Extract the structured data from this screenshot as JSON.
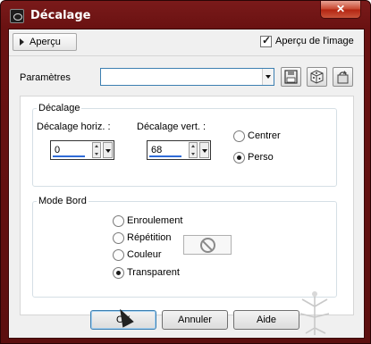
{
  "window": {
    "title": "Décalage",
    "close_glyph": "✕"
  },
  "toolbar": {
    "apercu_label": "Aperçu",
    "apercu_check_label": "Aperçu de l'image",
    "apercu_checked": true
  },
  "parametres": {
    "label": "Paramètres",
    "value": ""
  },
  "decalage": {
    "group_title": "Décalage",
    "horiz_label": "Décalage horiz. :",
    "horiz_value": "0",
    "vert_label": "Décalage vert. :",
    "vert_value": "68",
    "options": [
      {
        "label": "Centrer",
        "selected": false
      },
      {
        "label": "Perso",
        "selected": true
      }
    ]
  },
  "mode_bord": {
    "group_title": "Mode Bord",
    "options": [
      {
        "label": "Enroulement",
        "selected": false
      },
      {
        "label": "Répétition",
        "selected": false
      },
      {
        "label": "Couleur",
        "selected": false
      },
      {
        "label": "Transparent",
        "selected": true
      }
    ]
  },
  "buttons": {
    "ok": "OK",
    "cancel": "Annuler",
    "help": "Aide"
  },
  "icons": [
    "save-icon",
    "dice-icon",
    "reset-icon",
    "no-color-icon",
    "arrow-cursor-icon"
  ],
  "colors": {
    "titlebar": "#6a1212",
    "accent": "#2f6bd8",
    "close": "#c8452d"
  }
}
